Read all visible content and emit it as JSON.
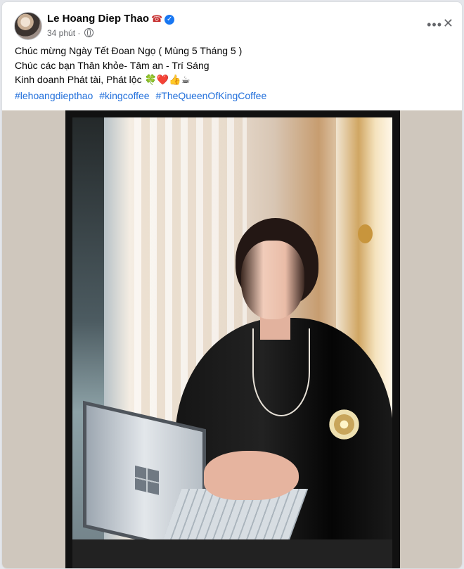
{
  "post": {
    "author": "Le Hoang Diep Thao",
    "time": "34 phút",
    "text_lines": [
      "Chúc mừng Ngày Tết Đoan Ngọ ( Mùng 5 Tháng 5 )",
      "Chúc các bạn Thân khỏe- Tâm an - Trí Sáng",
      "Kinh doanh Phát tài, Phát lộc 🍀❤️👍☕"
    ],
    "hashtags": [
      "#lehoangdiepthao",
      "#kingcoffee",
      "#TheQueenOfKingCoffee"
    ]
  },
  "icons": {
    "phone": "☎",
    "verified": "✓",
    "globe": "globe-icon",
    "more": "•••",
    "close": "✕"
  },
  "colors": {
    "link": "#216fdb",
    "verified": "#1877f2",
    "background": "#e4e6eb"
  }
}
